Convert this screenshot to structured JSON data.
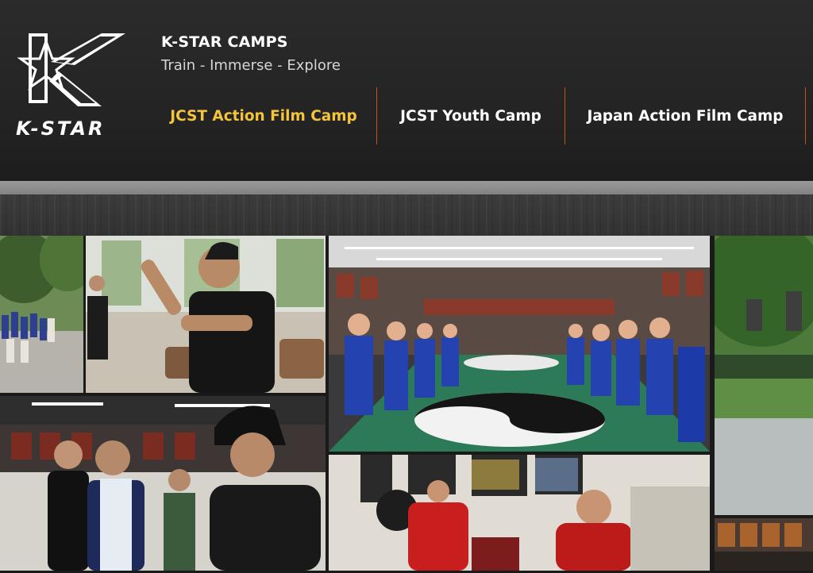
{
  "brand": {
    "logo_text": "K-STAR",
    "title": "K-STAR CAMPS",
    "tagline": "Train - Immerse - Explore"
  },
  "nav": {
    "items": [
      {
        "label": "JCST Action Film Camp",
        "active": true
      },
      {
        "label": "JCST Youth Camp",
        "active": false
      },
      {
        "label": "Japan Action Film Camp",
        "active": false
      }
    ]
  },
  "colors": {
    "active_nav": "#f4c43c",
    "nav_divider": "#c9521a",
    "header_bg": "#252525"
  },
  "gallery": {
    "photos": [
      {
        "subject": "outdoor-group-training-photo"
      },
      {
        "subject": "instructor-demonstration-photo"
      },
      {
        "subject": "training-hall-yin-yang-photo"
      },
      {
        "subject": "temple-courtyard-photo"
      },
      {
        "subject": "film-set-crew-photo"
      },
      {
        "subject": "interview-session-photo"
      },
      {
        "subject": "poster-wall-photo"
      }
    ]
  }
}
